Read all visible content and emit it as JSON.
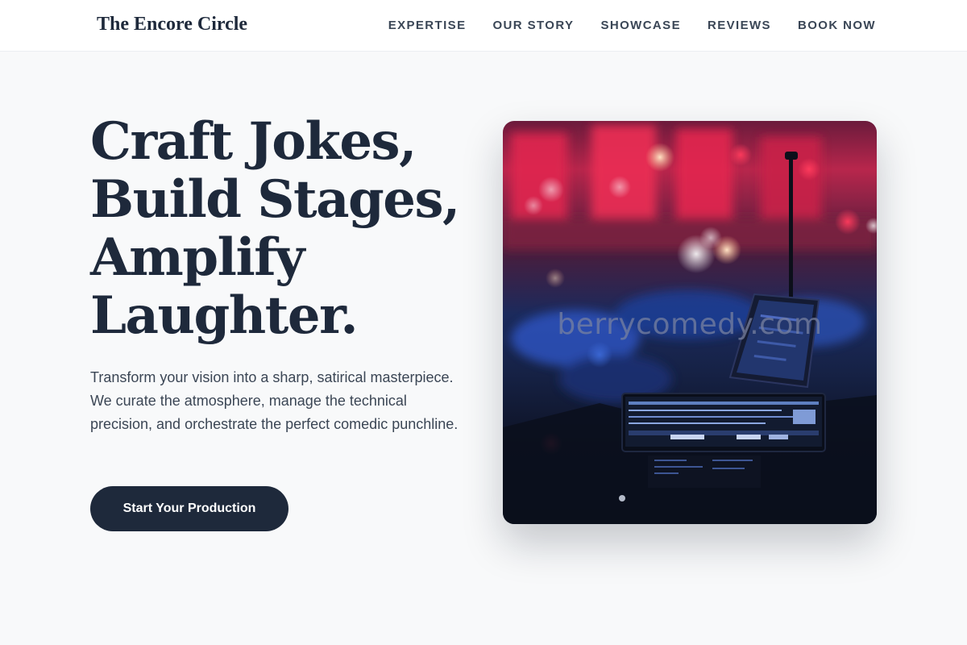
{
  "header": {
    "brand": "The Encore Circle",
    "nav": [
      {
        "label": "EXPERTISE"
      },
      {
        "label": "OUR STORY"
      },
      {
        "label": "SHOWCASE"
      },
      {
        "label": "REVIEWS"
      },
      {
        "label": "BOOK NOW"
      }
    ]
  },
  "hero": {
    "title_lines": [
      "Craft Jokes,",
      "Build Stages,",
      "Amplify",
      "Laughter."
    ],
    "description": "Transform your vision into a sharp, satirical masterpiece. We curate the atmosphere, manage the technical precision, and orchestrate the perfect comedic punchline.",
    "cta_label": "Start Your Production",
    "image_watermark": "berrycomedy.com"
  },
  "colors": {
    "primary": "#1e293b",
    "background": "#f8f9fa",
    "header_bg": "#ffffff",
    "stage_red": "#e8204a",
    "stage_blue": "#1f3c8f"
  }
}
